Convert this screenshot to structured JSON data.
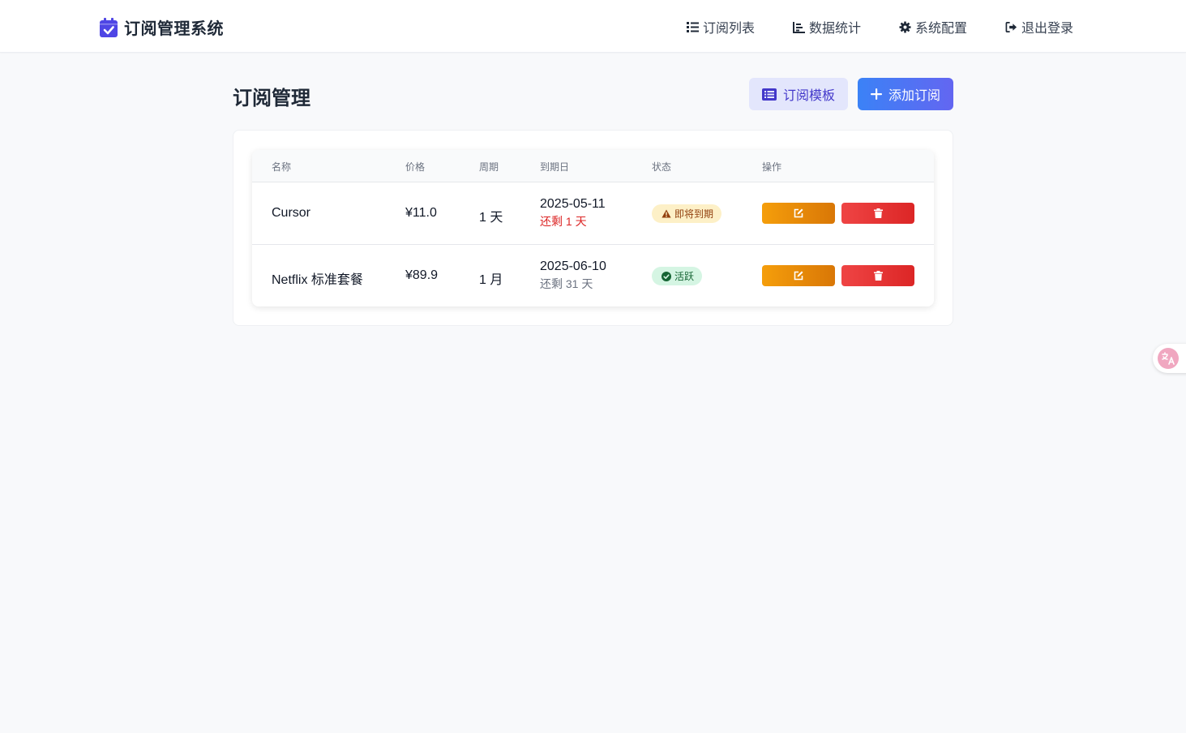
{
  "app": {
    "title": "订阅管理系统",
    "icon": "calendar-check-icon",
    "accent_color": "#4f46e5"
  },
  "nav": {
    "items": [
      {
        "label": "订阅列表",
        "icon": "list-icon"
      },
      {
        "label": "数据统计",
        "icon": "chart-bar-icon"
      },
      {
        "label": "系统配置",
        "icon": "gear-icon"
      },
      {
        "label": "退出登录",
        "icon": "sign-out-icon"
      }
    ]
  },
  "page": {
    "title": "订阅管理"
  },
  "actions": {
    "template_label": "订阅模板",
    "template_icon": "list-alt-icon",
    "add_label": "添加订阅",
    "add_icon": "plus-icon"
  },
  "table": {
    "headers": [
      "名称",
      "价格",
      "周期",
      "到期日",
      "状态",
      "操作"
    ],
    "rows": [
      {
        "name": "Cursor",
        "price": "¥11.0",
        "cycle": "1 天",
        "expiry": "2025-05-11",
        "remaining": "还剩 1 天",
        "status": "即将到期",
        "status_icon": "warning-icon",
        "status_color": "#92400e"
      },
      {
        "name": "Netflix 标准套餐",
        "price": "¥89.9",
        "cycle": "1 月",
        "expiry": "2025-06-10",
        "remaining": "还剩 31 天",
        "status": "活跃",
        "status_icon": "check-circle-icon",
        "status_color": "#166534"
      }
    ],
    "edit_icon": "edit-icon",
    "delete_icon": "trash-icon"
  },
  "floating": {
    "icon": "translate-icon"
  }
}
